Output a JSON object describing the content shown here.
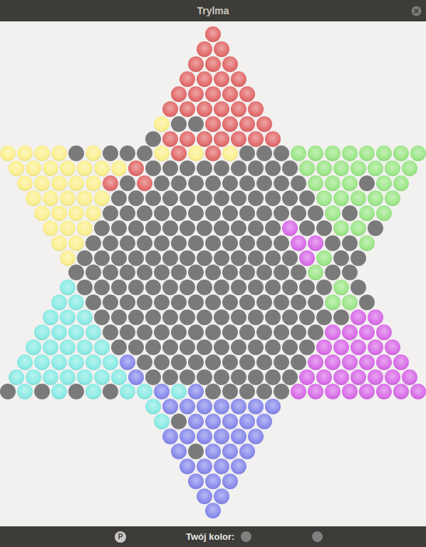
{
  "window": {
    "title": "Trylma"
  },
  "board": {
    "empty": "E",
    "colors": {
      "E": "#7a7a7a",
      "R": "#df5c5c",
      "Y": "#fbee84",
      "G": "#93e47d",
      "M": "#d55ee6",
      "B": "#7d7fea",
      "C": "#7fe9e2"
    },
    "rows": [
      "R",
      "RR",
      "RRR",
      "RRRR",
      "RRRRR",
      "RRRRRR",
      "YEERRRR",
      "ERRRRRRR",
      "YYYYEYEEEYRYRYEEEGGGGGGGG",
      "YYYYYYYREEEEEEEEEGGGGGGG",
      "YYYYYREREEEEEEEEEGGGEGG",
      "YYYYYEEEEEEEEEEEEGGGGG",
      "YYYYEEEEEEEEEEEEEGEGG",
      "YYYEEEEEEEEEEEMEEGGE",
      "YYEEEEEEEEEEEEMMEEG",
      "YEEEEEEEEEEEEEMGEE",
      "EEEEEEEEEEEEEEGEE",
      "CEEEEEEEEEEEEEEEGE",
      "CCEEEEEEEEEEEEEEGGE",
      "CCCEEEEEEEEEEEEEEEMM",
      "CCCCEEEEEEEEEEEEEMMMM",
      "CCCCCEEEEEEEEEEEEMMMMM",
      "CCCCCCBEEEEEEEEEEMMMMMM",
      "CCCCCCCBEEEEEEEEEMMMMMMM",
      "ECECECECCBCBEEEEEMMMMMMMM",
      "CBBBBBBB",
      "CEBBBBB",
      "BBBBBB",
      "BEBBB",
      "BBBB",
      "BBB",
      "BB",
      "B"
    ]
  },
  "status_bar": {
    "pause_button": "P",
    "label": "Twój kolor:",
    "your_color": "#808080",
    "turn_color": "#808080"
  }
}
